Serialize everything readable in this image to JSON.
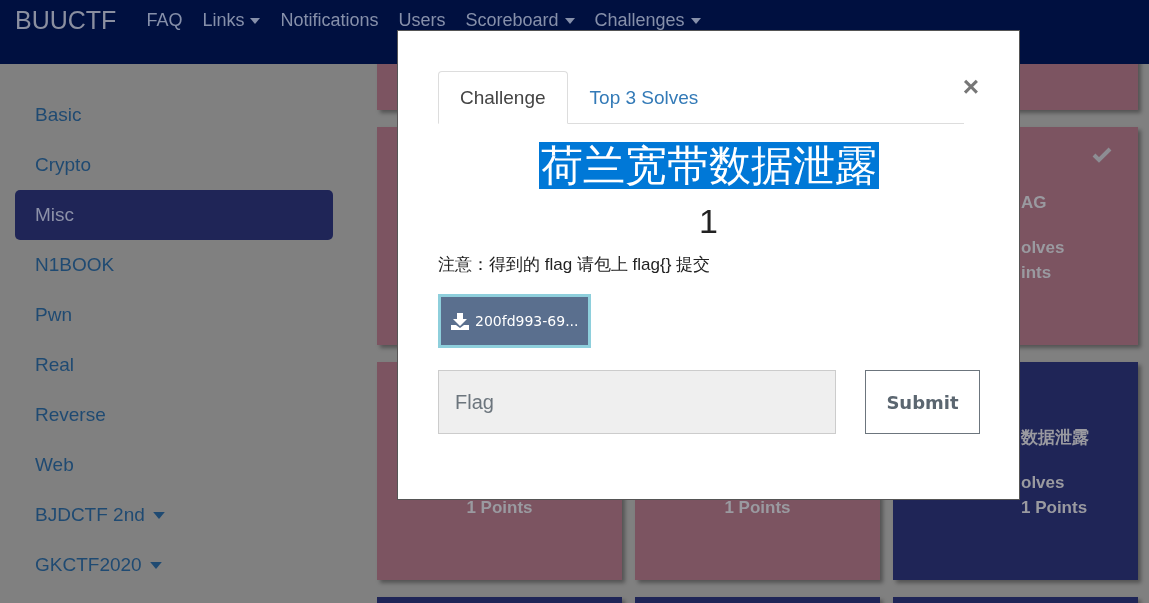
{
  "navbar": {
    "brand": "BUUCTF",
    "items": [
      {
        "label": "FAQ",
        "dropdown": false
      },
      {
        "label": "Links",
        "dropdown": true
      },
      {
        "label": "Notifications",
        "dropdown": false
      },
      {
        "label": "Users",
        "dropdown": false
      },
      {
        "label": "Scoreboard",
        "dropdown": true
      },
      {
        "label": "Challenges",
        "dropdown": true
      }
    ]
  },
  "sidebar": {
    "items": [
      {
        "label": "Basic",
        "selected": false,
        "dropdown": false
      },
      {
        "label": "Crypto",
        "selected": false,
        "dropdown": false
      },
      {
        "label": "Misc",
        "selected": true,
        "dropdown": false
      },
      {
        "label": "N1BOOK",
        "selected": false,
        "dropdown": false
      },
      {
        "label": "Pwn",
        "selected": false,
        "dropdown": false
      },
      {
        "label": "Real",
        "selected": false,
        "dropdown": false
      },
      {
        "label": "Reverse",
        "selected": false,
        "dropdown": false
      },
      {
        "label": "Web",
        "selected": false,
        "dropdown": false
      },
      {
        "label": "BJDCTF 2nd",
        "selected": false,
        "dropdown": true
      },
      {
        "label": "GKCTF2020",
        "selected": false,
        "dropdown": true
      }
    ]
  },
  "challenge_rows": [
    {
      "left": {
        "solved": true
      },
      "right": {
        "solved": true
      }
    },
    {
      "left": {
        "solved": true
      },
      "right": {
        "solved": true,
        "title": "AG",
        "solves": "olves",
        "points": "ints"
      }
    },
    {
      "left": {
        "solved": true,
        "points": "1 Points"
      },
      "middle": {
        "solved": true,
        "points": "1 Points"
      },
      "right": {
        "solved": false,
        "title": "数据泄露",
        "solves": "olves",
        "points": "1 Points"
      }
    },
    {
      "left": {
        "solved": false
      },
      "middle": {
        "solved": false
      },
      "right": {
        "solved": false
      }
    }
  ],
  "modal": {
    "tabs": [
      {
        "label": "Challenge",
        "selected": true
      },
      {
        "label": "Top 3 Solves",
        "selected": false
      }
    ],
    "close": "×",
    "title": "荷兰宽带数据泄露",
    "title_highlighted": true,
    "value": "1",
    "description": "注意：得到的 flag 请包上 flag{} 提交",
    "download": "200fd993-69...",
    "flag_placeholder": "Flag",
    "submit": "Submit"
  }
}
